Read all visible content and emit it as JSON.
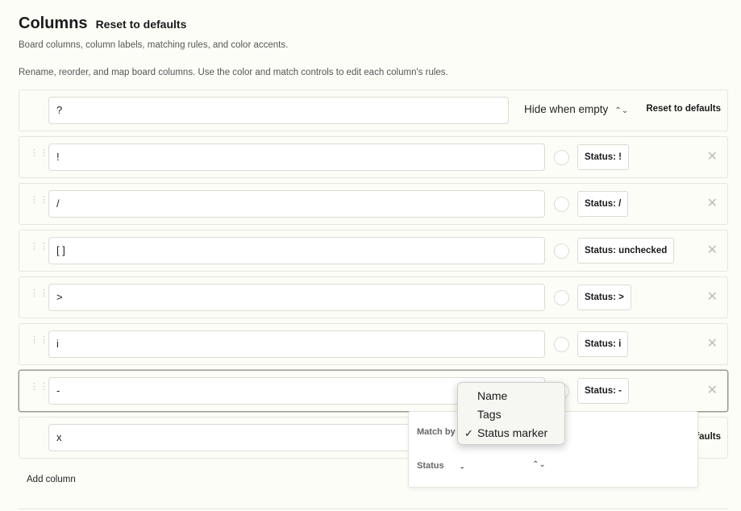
{
  "header": {
    "title": "Columns",
    "reset_label": "Reset to defaults",
    "subtitle": "Board columns, column labels, matching rules, and color accents.",
    "help": "Rename, reorder, and map board columns. Use the color and match controls to edit each column's rules."
  },
  "top_row": {
    "name": "?",
    "hide_label": "Hide when empty",
    "reset_label": "Reset to defaults"
  },
  "columns": [
    {
      "name": "!",
      "status": "Status: !"
    },
    {
      "name": "/",
      "status": "Status: /"
    },
    {
      "name": "[ ]",
      "status": "Status: unchecked"
    },
    {
      "name": ">",
      "status": "Status: >"
    },
    {
      "name": "i",
      "status": "Status: i"
    },
    {
      "name": "-",
      "status": "Status: -"
    }
  ],
  "bottom_row": {
    "name": "x",
    "reset_partial": "efaults"
  },
  "add_column_label": "Add column",
  "popover": {
    "match_by_label": "Match by",
    "status_label": "Status",
    "status_value": "-"
  },
  "dropdown": {
    "options": [
      "Name",
      "Tags",
      "Status marker"
    ],
    "selected": "Status marker",
    "check": "✓"
  },
  "icons": {
    "drag": "drag-handle-icon",
    "close": "close-icon",
    "chevron": "up-down-chevron-icon"
  }
}
